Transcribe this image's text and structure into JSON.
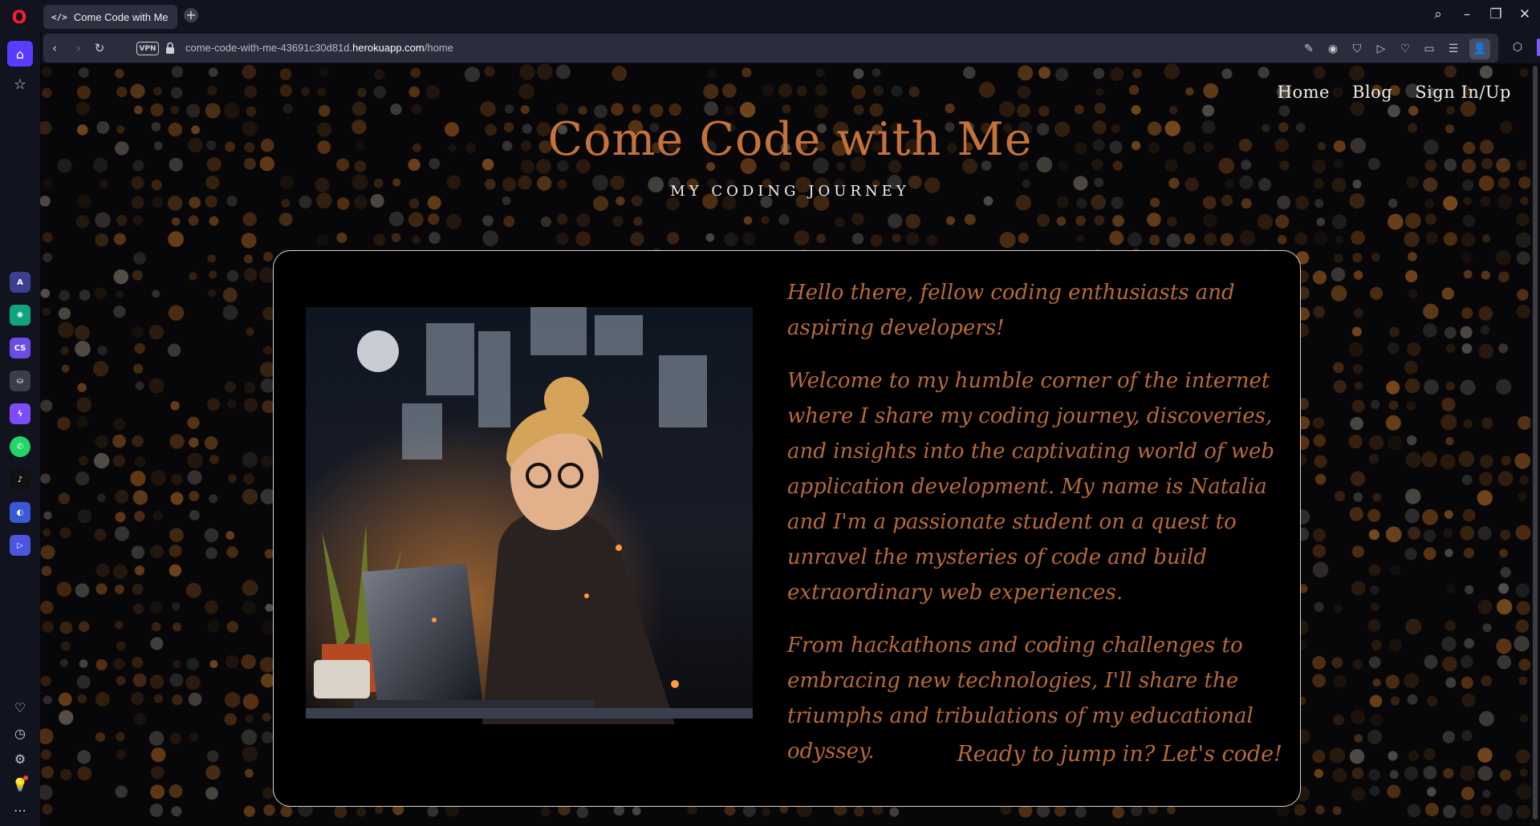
{
  "browser": {
    "tab": {
      "icon": "</>",
      "title": "Come Code with Me"
    },
    "url": {
      "prefix": "come-code-with-me-43691c30d81d.",
      "host": "herokuapp.com",
      "path": "/home"
    },
    "vpn_label": "VPN"
  },
  "site": {
    "nav": {
      "home": "Home",
      "blog": "Blog",
      "signin": "Sign In/Up"
    },
    "title": "Come Code with Me",
    "subtitle": "MY CODING JOURNEY"
  },
  "intro": {
    "greeting": "Hello there, fellow coding enthusiasts and aspiring developers!",
    "welcome": "Welcome to my humble corner of the internet where I share my coding journey, discoveries, and insights into the captivating world of web application development. My name is Natalia and I'm a passionate student on a quest to unravel the mysteries of code and build extraordinary web experiences.",
    "journey": "From hackathons and coding challenges to embracing new technologies, I'll share the triumphs and tribulations of my educational odyssey.",
    "cta": "Ready to jump in? Let's code!"
  },
  "colors": {
    "accent": "#c4713c",
    "text_orange": "#b7693a",
    "opera_red": "#ff1b2d",
    "sidebar_active": "#5a3cff"
  }
}
